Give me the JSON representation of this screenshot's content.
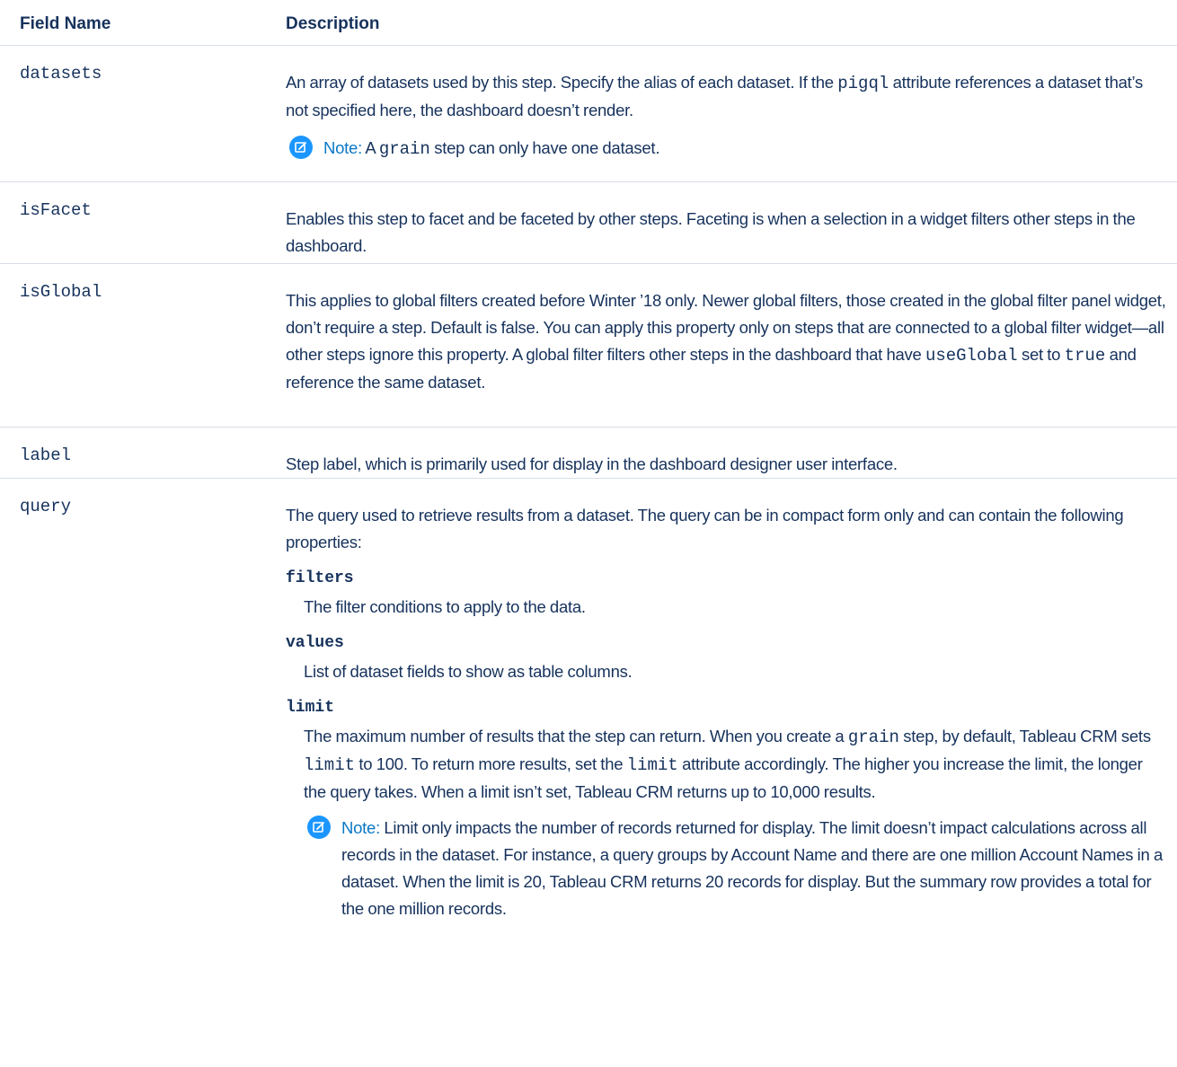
{
  "header": {
    "field_name": "Field Name",
    "description": "Description"
  },
  "rows": {
    "datasets": {
      "name": "datasets",
      "d1": "An array of datasets used by this step. Specify the alias of each dataset. If the",
      "code1": "pigql",
      "d2": "attribute references a dataset that’s not specified here, the dashboard doesn’t render.",
      "note_label": "Note:",
      "note1": "A",
      "note_code": "grain",
      "note2": "step can only have one dataset."
    },
    "isFacet": {
      "name": "isFacet",
      "d1": "Enables this step to facet and be faceted by other steps. Faceting is when a selection in a widget filters other steps in the dashboard."
    },
    "isGlobal": {
      "name": "isGlobal",
      "d1": "This applies to global filters created before Winter ’18 only. Newer global filters, those created in the global filter panel widget, don’t require a step. Default is false. You can apply this property only on steps that are connected to a global filter widget—all other steps ignore this property. A global filter filters other steps in the dashboard that have",
      "code1": "useGlobal",
      "d2": "set to",
      "code2": "true",
      "d3": "and reference the same dataset."
    },
    "label": {
      "name": "label",
      "d1": "Step label, which is primarily used for display in the dashboard designer user interface."
    },
    "query": {
      "name": "query",
      "intro": "The query used to retrieve results from a dataset. The query can be in compact form only and can contain the following properties:",
      "filters_name": "filters",
      "filters_desc": "The filter conditions to apply to the data.",
      "values_name": "values",
      "values_desc": "List of dataset fields to show as table columns.",
      "limit_name": "limit",
      "limit_d1": "The maximum number of results that the step can return. When you create a",
      "limit_code1": "grain",
      "limit_d2": "step, by default, Tableau CRM sets",
      "limit_code2": "limit",
      "limit_d3": "to 100. To return more results, set the",
      "limit_code3": "limit",
      "limit_d4": "attribute accordingly. The higher you increase the limit, the longer the query takes. When a limit isn’t set, Tableau CRM returns up to 10,000 results.",
      "note_label": "Note:",
      "note_text": "Limit only impacts the number of records returned for display. The limit doesn’t impact calculations across all records in the dataset. For instance, a query groups by Account Name and there are one million Account Names in a dataset. When the limit is 20, Tableau CRM returns 20 records for display. But the summary row provides a total for the one million records."
    }
  },
  "colors": {
    "text": "#16325c",
    "note_accent": "#0b78c6",
    "note_icon": "#1b96ff",
    "divider": "#d8dde6"
  },
  "icons": {
    "note": "edit-note-icon"
  }
}
